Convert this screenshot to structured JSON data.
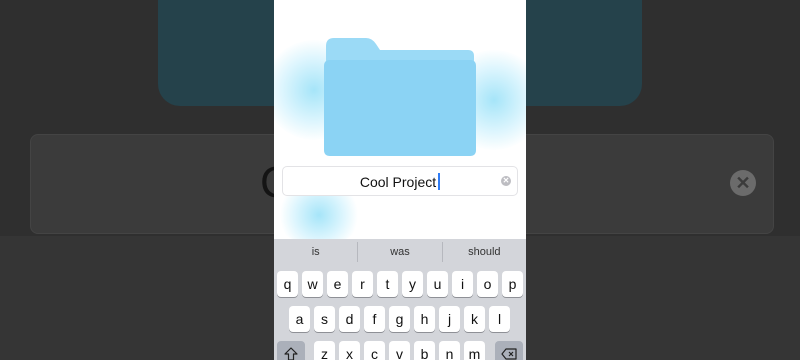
{
  "background": {
    "field_text": "C",
    "clear_icon": "x-circle-icon"
  },
  "folder": {
    "icon": "folder-icon",
    "color": "#8bd3f4"
  },
  "name_field": {
    "value": "Cool Project",
    "clear_icon": "x-circle-icon"
  },
  "keyboard": {
    "suggestions": [
      "is",
      "was",
      "should"
    ],
    "row1": [
      "q",
      "w",
      "e",
      "r",
      "t",
      "y",
      "u",
      "i",
      "o",
      "p"
    ],
    "row2": [
      "a",
      "s",
      "d",
      "f",
      "g",
      "h",
      "j",
      "k",
      "l"
    ],
    "row3": [
      "z",
      "x",
      "c",
      "v",
      "b",
      "n",
      "m"
    ],
    "shift_icon": "shift-icon",
    "delete_icon": "backspace-icon"
  },
  "colors": {
    "accent": "#2f7cf6",
    "keyboard_bg": "#d3d5da",
    "folder": "#8bd3f4"
  }
}
